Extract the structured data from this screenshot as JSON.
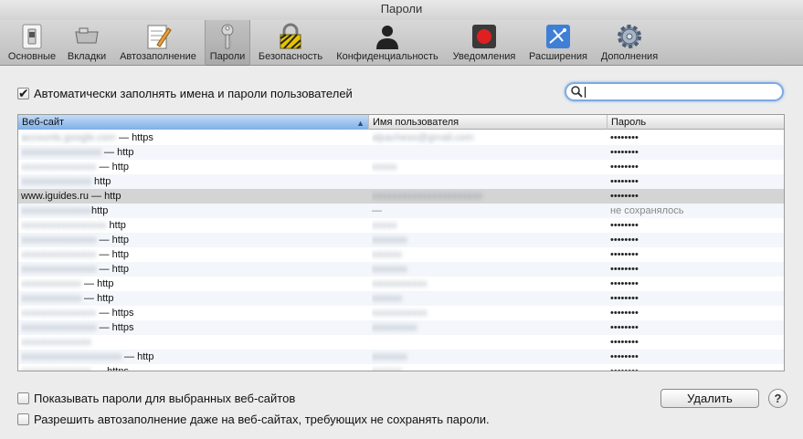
{
  "window": {
    "title": "Пароли"
  },
  "toolbar": {
    "items": [
      {
        "label": "Основные",
        "icon": "switch-icon"
      },
      {
        "label": "Вкладки",
        "icon": "tabs-icon"
      },
      {
        "label": "Автозаполнение",
        "icon": "pencil-icon"
      },
      {
        "label": "Пароли",
        "icon": "key-icon",
        "selected": true
      },
      {
        "label": "Безопасность",
        "icon": "lock-icon"
      },
      {
        "label": "Конфиденциальность",
        "icon": "silhouette-icon"
      },
      {
        "label": "Уведомления",
        "icon": "notification-icon"
      },
      {
        "label": "Расширения",
        "icon": "puzzle-icon"
      },
      {
        "label": "Дополнения",
        "icon": "gear-icon"
      }
    ]
  },
  "autofill": {
    "label": "Автоматически заполнять имена и пароли пользователей",
    "checked": true
  },
  "search": {
    "value": "",
    "placeholder": ""
  },
  "table": {
    "columns": [
      "Веб-сайт",
      "Имя пользователя",
      "Пароль"
    ],
    "sorted_column": 0,
    "rows": [
      {
        "site_hidden": "accounts.google.com",
        "site_suffix": " — https",
        "user": "alpacheso@gmail.com",
        "password": "••••••••"
      },
      {
        "site_hidden": "xxxxxxxxxxxxxxxx",
        "site_suffix": " — http",
        "user": "",
        "password": "••••••••"
      },
      {
        "site_hidden": "xxxxxxxxxxxxxxx",
        "site_suffix": " — http",
        "user": "xxxxx",
        "password": "••••••••"
      },
      {
        "site_hidden": "xxxxxxxxxxxxxx",
        "site_suffix": "  http",
        "user": "",
        "password": "••••••••"
      },
      {
        "site": "www.iguides.ru — http",
        "user_hidden": "xxxxxxxxxxxxxxxxxxxxxx",
        "password": "••••••••",
        "selected": true
      },
      {
        "site_hidden": "xxxxxxxxxxxxxx",
        "site_suffix": "http",
        "user": "—",
        "password": "не сохранялось"
      },
      {
        "site_hidden": "xxxxxxxxxxxxxxxxx",
        "site_suffix": " http",
        "user": "xxxxx",
        "password": "••••••••"
      },
      {
        "site_hidden": "xxxxxxxxxxxxxxx",
        "site_suffix": " — http",
        "user": "xxxxxxx",
        "password": "••••••••"
      },
      {
        "site_hidden": "xxxxxxxxxxxxxxx",
        "site_suffix": " — http",
        "user": "xxxxxx",
        "password": "••••••••"
      },
      {
        "site_hidden": "xxxxxxxxxxxxxxx",
        "site_suffix": " — http",
        "user": "xxxxxxx",
        "password": "••••••••"
      },
      {
        "site_hidden": "xxxxxxxxxxxx",
        "site_suffix": " — http",
        "user": "xxxxxxxxxxx",
        "password": "••••••••"
      },
      {
        "site_hidden": "xxxxxxxxxxxx",
        "site_suffix": " — http",
        "user": "xxxxxx",
        "password": "••••••••"
      },
      {
        "site_hidden": "xxxxxxxxxxxxxxx",
        "site_suffix": " — https",
        "user": "xxxxxxxxxxx",
        "password": "••••••••"
      },
      {
        "site_hidden": "xxxxxxxxxxxxxxx",
        "site_suffix": " — https",
        "user": "xxxxxxxxx",
        "password": "••••••••"
      },
      {
        "site_hidden": "xxxxxxxxxxxxxx",
        "site_suffix": "",
        "user": "",
        "password": "••••••••"
      },
      {
        "site_hidden": "xxxxxxxxxxxxxxxxxxxx",
        "site_suffix": " — http",
        "user": "xxxxxxx",
        "password": "••••••••"
      },
      {
        "site_hidden": "xxxxxxxxxxxxxx",
        "site_suffix": " — https",
        "user": "xxxxxx",
        "password": "••••••••"
      }
    ]
  },
  "show_passwords": {
    "label": "Показывать пароли для выбранных веб-сайтов",
    "checked": false
  },
  "remove_button": {
    "label": "Удалить"
  },
  "help_button": {
    "label": "?"
  },
  "allow_autofill": {
    "label": "Разрешить автозаполнение даже на веб-сайтах, требующих не сохранять пароли.",
    "checked": false
  }
}
